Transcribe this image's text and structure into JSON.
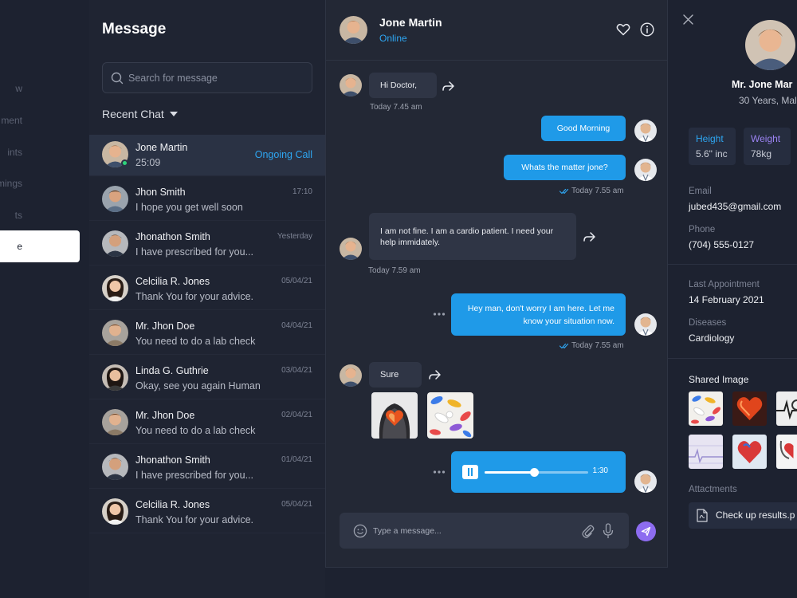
{
  "colors": {
    "background": "#1d2230",
    "accent_blue": "#1f9ae8",
    "accent_purple": "#8d6cf0",
    "online_green": "#2fd37c",
    "height_color": "#2ea6f2",
    "weight_color": "#9c83f3"
  },
  "nav": {
    "items": [
      {
        "label": "w",
        "active": false
      },
      {
        "label": "ment",
        "active": false
      },
      {
        "label": "ints",
        "active": false
      },
      {
        "label": "e Timings",
        "active": false
      },
      {
        "label": "ts",
        "active": false
      },
      {
        "label": "e",
        "active": true
      }
    ]
  },
  "list": {
    "title": "Message",
    "search_placeholder": "Search for message",
    "search_icon": "search-icon",
    "recent_label": "Recent Chat",
    "chats": [
      {
        "name": "Jone Martin",
        "preview": "25:09",
        "time": "",
        "status": "Ongoing Call",
        "active": true
      },
      {
        "name": "Jhon Smith",
        "preview": "I hope you get well soon",
        "time": "17:10"
      },
      {
        "name": "Jhonathon Smith",
        "preview": "I have prescribed for you...",
        "time": "Yesterday"
      },
      {
        "name": "Celcilia R. Jones",
        "preview": "Thank You for your advice.",
        "time": "05/04/21"
      },
      {
        "name": "Mr. Jhon Doe",
        "preview": "You need to do a lab check",
        "time": "04/04/21"
      },
      {
        "name": "Linda G. Guthrie",
        "preview": "Okay, see you again Human",
        "time": "03/04/21"
      },
      {
        "name": "Mr. Jhon Doe",
        "preview": "You need to do a lab check",
        "time": "02/04/21"
      },
      {
        "name": "Jhonathon Smith",
        "preview": "I have prescribed for you...",
        "time": "01/04/21"
      },
      {
        "name": "Celcilia R. Jones",
        "preview": "Thank You for your advice.",
        "time": "05/04/21"
      }
    ]
  },
  "conversation": {
    "contact_name": "Jone Martin",
    "contact_status": "Online",
    "messages": {
      "m1": {
        "text": "Hi Doctor,",
        "time": "Today 7.45 am"
      },
      "m2": {
        "text": "Good Morning"
      },
      "m3": {
        "text": "Whats the matter jone?",
        "time": "Today 7.55 am"
      },
      "m4": {
        "line1": "I am not fine. I am a cardio patient. I need your",
        "line2": "help immidately.",
        "time": "Today 7.59 am"
      },
      "m5": {
        "line1": "Hey man, don't worry I am here. Let me",
        "line2": "know your situation now.",
        "time": "Today 7.55 am"
      },
      "m6": {
        "text": "Sure"
      }
    },
    "voice": {
      "duration": "1:30",
      "progress": 0.48
    },
    "composer_placeholder": "Type a message..."
  },
  "profile": {
    "name": "Mr. Jone Mar",
    "age": "30 Years, Mal",
    "height_label": "Height",
    "height_value": "5.6\" inc",
    "weight_label": "Weight",
    "weight_value": "78kg",
    "email_label": "Email",
    "email": "jubed435@gmail.com",
    "phone_label": "Phone",
    "phone": "(704) 555-0127",
    "last_appointment_label": "Last Appointment",
    "last_appointment": "14 February 2021",
    "diseases_label": "Diseases",
    "diseases": "Cardiology",
    "shared_image_label": "Shared Image",
    "attachments_label": "Attactments",
    "attachment_file": "Check up results.p"
  }
}
